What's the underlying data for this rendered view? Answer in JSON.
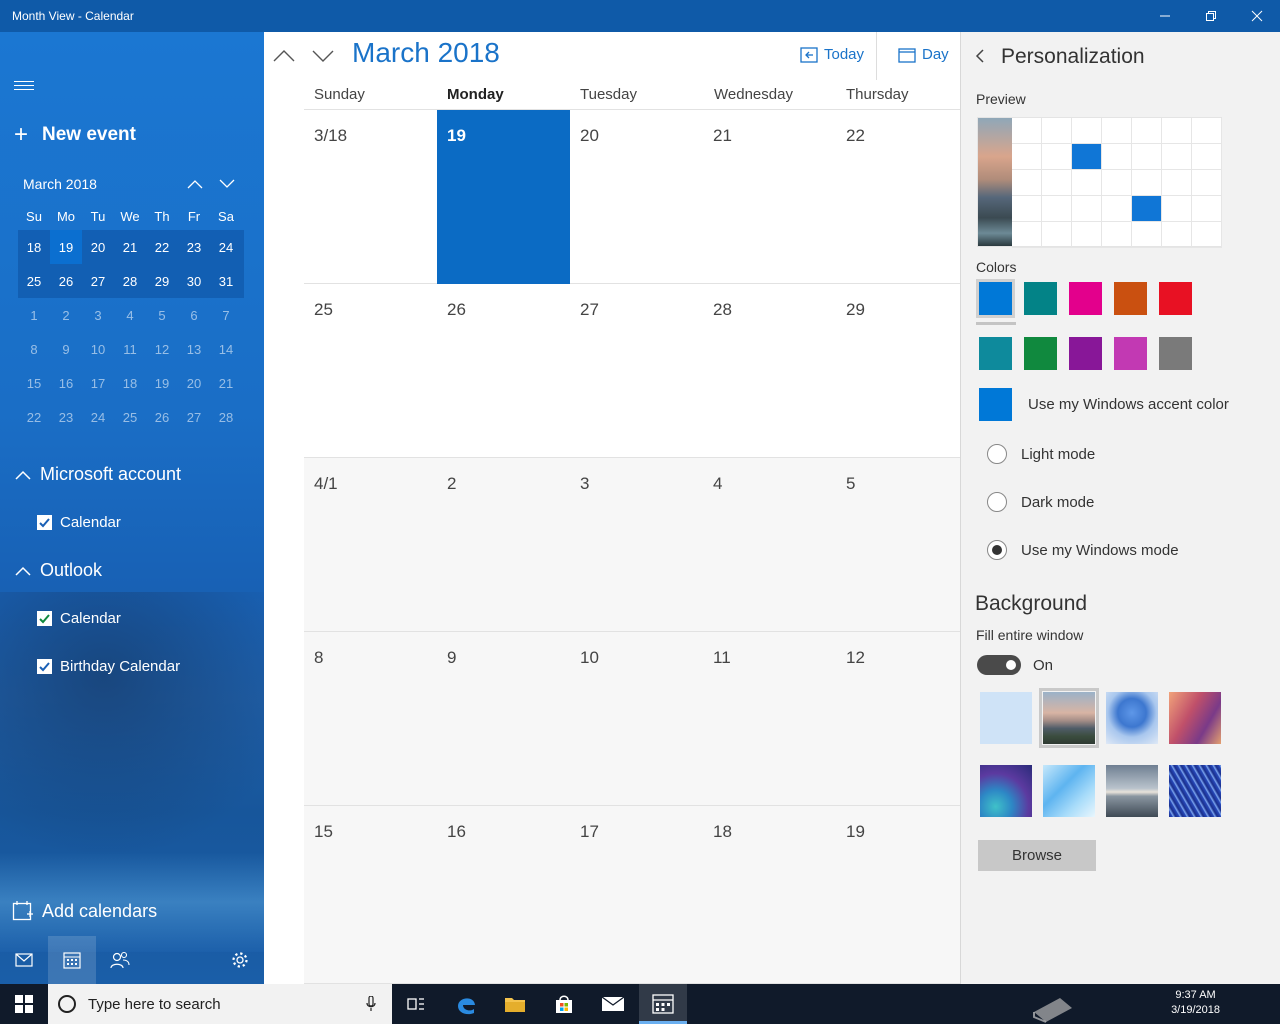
{
  "window": {
    "title": "Month View - Calendar"
  },
  "left": {
    "new_event": "New event",
    "mini_month": "March 2018",
    "dow": [
      "Su",
      "Mo",
      "Tu",
      "We",
      "Th",
      "Fr",
      "Sa"
    ],
    "weeks": [
      [
        "18",
        "19",
        "20",
        "21",
        "22",
        "23",
        "24"
      ],
      [
        "25",
        "26",
        "27",
        "28",
        "29",
        "30",
        "31"
      ],
      [
        "1",
        "2",
        "3",
        "4",
        "5",
        "6",
        "7"
      ],
      [
        "8",
        "9",
        "10",
        "11",
        "12",
        "13",
        "14"
      ],
      [
        "15",
        "16",
        "17",
        "18",
        "19",
        "20",
        "21"
      ],
      [
        "22",
        "23",
        "24",
        "25",
        "26",
        "27",
        "28"
      ]
    ],
    "accounts": [
      {
        "name": "Microsoft account",
        "calendars": [
          "Calendar"
        ]
      },
      {
        "name": "Outlook",
        "calendars": [
          "Calendar",
          "Birthday Calendar"
        ]
      }
    ],
    "add_calendars": "Add calendars"
  },
  "main": {
    "month_title": "March 2018",
    "today_label": "Today",
    "view_label": "Day",
    "weekdays": [
      "Sunday",
      "Monday",
      "Tuesday",
      "Wednesday",
      "Thursday"
    ],
    "weeks": [
      [
        "3/18",
        "19",
        "20",
        "21",
        "22"
      ],
      [
        "25",
        "26",
        "27",
        "28",
        "29"
      ],
      [
        "4/1",
        "2",
        "3",
        "4",
        "5"
      ],
      [
        "8",
        "9",
        "10",
        "11",
        "12"
      ],
      [
        "15",
        "16",
        "17",
        "18",
        "19"
      ]
    ]
  },
  "personalization": {
    "title": "Personalization",
    "preview_label": "Preview",
    "colors_label": "Colors",
    "colors": [
      "#0078d7",
      "#038387",
      "#e3008c",
      "#ca5010",
      "#e81123",
      "#0e8a9c",
      "#10893e",
      "#881798",
      "#c239b3",
      "#7a7a7a"
    ],
    "accent_label": "Use my Windows accent color",
    "accent_color": "#0078d7",
    "modes": [
      "Light mode",
      "Dark mode",
      "Use my Windows mode"
    ],
    "selected_mode": "Use my Windows mode",
    "background_label": "Background",
    "fill_label": "Fill entire window",
    "fill_state": "On",
    "browse_label": "Browse"
  },
  "taskbar": {
    "search_placeholder": "Type here to search",
    "time": "9:37 AM",
    "date": "3/19/2018"
  }
}
